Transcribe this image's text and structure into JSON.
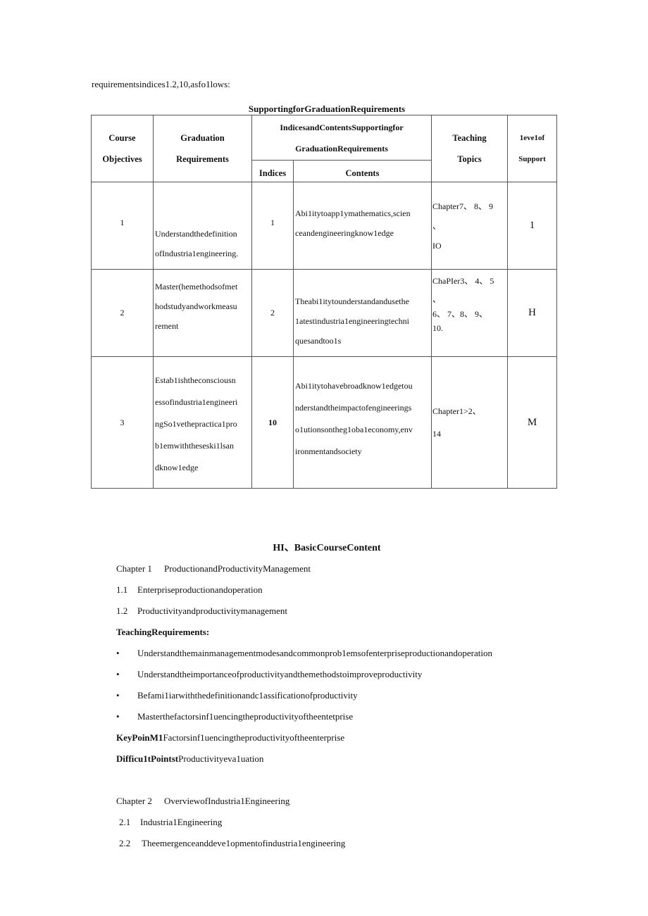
{
  "intro_text": "requirementsindices1.2,10,asfo1lows:",
  "table": {
    "title": "SupportingforGraduationRequirements",
    "headers": {
      "course_objectives": [
        "Course",
        "Objectives"
      ],
      "graduation_requirements": [
        "Graduation",
        "Requirements"
      ],
      "indices_contents_group": [
        "IndicesandContentsSupportingfor",
        "GraduationRequirements"
      ],
      "indices": "Indices",
      "contents": "Contents",
      "teaching_topics": [
        "Teaching",
        "Topics"
      ],
      "level_of_support": [
        "1eve1of",
        "Support"
      ]
    },
    "rows": [
      {
        "objective": "1",
        "requirement": [
          "",
          "Understandthedefinition",
          "ofIndustria1engineering."
        ],
        "index": "1",
        "content": [
          "Abi1itytoapp1ymathematics,scien",
          "ceandengineeringknow1edge"
        ],
        "topics": [
          "Chapter7、 8、 9",
          "、",
          "IO"
        ],
        "level": "1"
      },
      {
        "objective": "2",
        "requirement": [
          "Master(hemethodsofmet",
          "hodstudyandworkmeasu",
          "rement"
        ],
        "index": "2",
        "content": [
          "Theabi1itytounderstandandusethe",
          "1atestindustria1engineeringtechni",
          "quesandtoo1s"
        ],
        "topics": [
          "ChaPIer3、 4、 5",
          "、",
          "6、 7、8、 9、",
          "10."
        ],
        "level": "H"
      },
      {
        "objective": "3",
        "requirement": [
          "Estab1ishtheconsciousn",
          "essofindustria1engineeri",
          "ngSo1vethepractica1pro",
          "b1emwiththeseski1lsan",
          "dknow1edge"
        ],
        "index": "10",
        "content": [
          "Abi1itytohavebroadknow1edgetou",
          "nderstandtheimpactofengineerings",
          "o1utionsontheg1oba1economy,env",
          "ironmentandsociety"
        ],
        "topics": [
          "Chapter1>2、",
          "14"
        ],
        "level": "M"
      }
    ]
  },
  "section": {
    "heading": "HI、BasicCourseContent",
    "chapter1": {
      "label": "Chapter 1",
      "title": "ProductionandProductivityManagement",
      "items": [
        {
          "num": "1.1",
          "text": "Enterpriseproductionandoperation"
        },
        {
          "num": "1.2",
          "text": "Productivityandproductivitymanagement"
        }
      ],
      "teaching_requirements_label": "TeachingRequirements:",
      "bullets": [
        "Understandthemainmanagementmodesandcommonprob1emsofenterpriseproductionandoperation",
        "Understandtheimportanceofproductivityandthemethodstoimproveproductivity",
        "Befami1iarwiththedefinitionandc1assificationofproductivity",
        "Masterthefactorsinf1uencingtheproductivityoftheentetprise"
      ],
      "key_point_label": "KeyPoinM1",
      "key_point_text": "Factorsinf1uencingtheproductivityoftheenterprise",
      "difficult_label": "Difficu1tPointst",
      "difficult_text": "Productivityeva1uation"
    },
    "chapter2": {
      "label": "Chapter 2",
      "title": "OverviewofIndustria1Engineering",
      "items": [
        {
          "num": "2.1",
          "text": "Industria1Engineering"
        },
        {
          "num": "2.2",
          "text": "Theemergenceanddeve1opmentofindustria1engineering"
        }
      ]
    }
  }
}
